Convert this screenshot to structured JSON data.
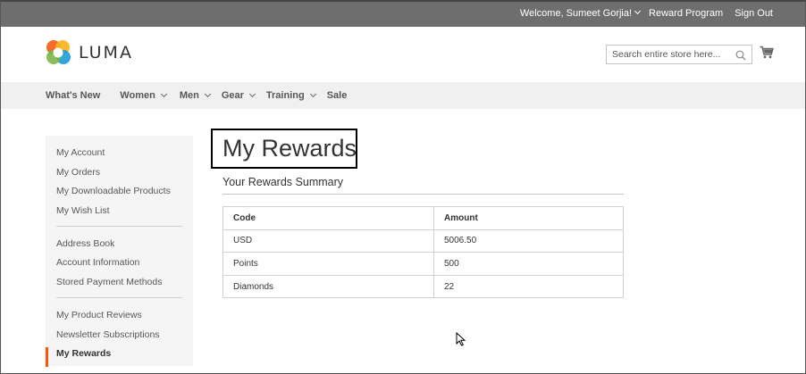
{
  "topbar": {
    "welcome": "Welcome, Sumeet Gorjia!",
    "reward_program": "Reward Program",
    "sign_out": "Sign Out"
  },
  "header": {
    "logo_text": "LUMA",
    "search_placeholder": "Search entire store here..."
  },
  "nav": {
    "items": [
      {
        "label": "What's New"
      },
      {
        "label": "Women"
      },
      {
        "label": "Men"
      },
      {
        "label": "Gear"
      },
      {
        "label": "Training"
      },
      {
        "label": "Sale"
      }
    ]
  },
  "sidebar": {
    "items": [
      "My Account",
      "My Orders",
      "My Downloadable Products",
      "My Wish List",
      "Address Book",
      "Account Information",
      "Stored Payment Methods",
      "My Product Reviews",
      "Newsletter Subscriptions",
      "My Rewards"
    ]
  },
  "main": {
    "title": "My Rewards",
    "subtitle": "Your Rewards Summary",
    "table": {
      "headers": [
        "Code",
        "Amount"
      ],
      "rows": [
        [
          "USD",
          "5006.50"
        ],
        [
          "Points",
          "500"
        ],
        [
          "Diamonds",
          "22"
        ]
      ]
    }
  },
  "colors": {
    "topbar_bg": "#6e6e6e",
    "nav_bg": "#f0f0f0",
    "sidebar_bg": "#f5f5f5",
    "active_accent": "#ff5501"
  }
}
